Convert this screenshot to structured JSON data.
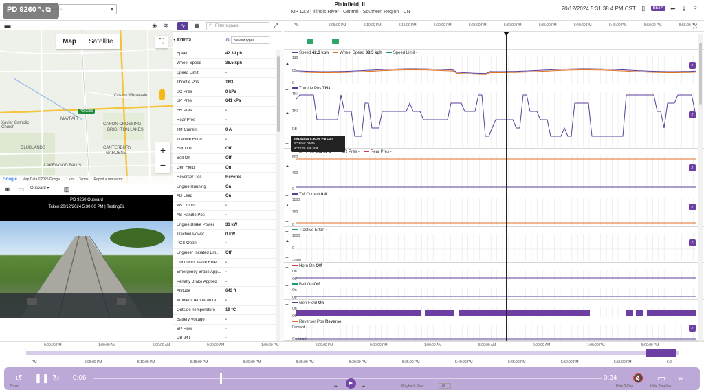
{
  "header": {
    "badge": "PD 9260",
    "signal_placeholder": "Signals",
    "location": "Plainfield, IL",
    "subtitle": "MP 12.8 | Illinois River · Central · Southern Region · CN",
    "datetime": "20/12/2024 5:31:38.4 PM CST",
    "beta": "BETA"
  },
  "map": {
    "tab_map": "Map",
    "tab_satellite": "Satellite",
    "labels": [
      "Costco Wholesale",
      "PD 9260",
      "CLUBLANDS",
      "Xavier Catholic Church",
      "LAKEWOOD FALLS",
      "CANTERBURY",
      "GARDENS",
      "CARON CROSSING",
      "BRIGHTON LAKES",
      "MAYFAIR"
    ],
    "footer_data": "Map Data ©2025 Google",
    "footer_scale": "1 km",
    "footer_terms": "Terms",
    "footer_report": "Report a map error",
    "google": "Google"
  },
  "video": {
    "camera_select": "Outward",
    "caption1": "PD 9260 Outward",
    "caption2": "Taken 20/12/2024 5:30:00 PM | TestingBL"
  },
  "signals": {
    "filter_placeholder": "Filter signals",
    "events_label": "EVENTS",
    "events_select": "3 event types",
    "rows": [
      {
        "name": "Speed",
        "value": "42.3 kph"
      },
      {
        "name": "Wheel Speed",
        "value": "38.5 kph"
      },
      {
        "name": "Speed Limit",
        "value": "-"
      },
      {
        "name": "Throttle Pos",
        "value": "TN3"
      },
      {
        "name": "BC Pres",
        "value": "0 kPa"
      },
      {
        "name": "BP Pres",
        "value": "641 kPa"
      },
      {
        "name": "ER Pres",
        "value": "-"
      },
      {
        "name": "Rear Pres",
        "value": "-"
      },
      {
        "name": "TM Current",
        "value": "0 A"
      },
      {
        "name": "Tractive Effort",
        "value": "-"
      },
      {
        "name": "Horn On",
        "value": "Off"
      },
      {
        "name": "Bell On",
        "value": "Off"
      },
      {
        "name": "Gen Field",
        "value": "On"
      },
      {
        "name": "Reverser Pos",
        "value": "Reverse"
      },
      {
        "name": "Engine Running",
        "value": "On"
      },
      {
        "name": "AB Lead",
        "value": "On"
      },
      {
        "name": "AB Cutout",
        "value": "-"
      },
      {
        "name": "AB Handle Pos",
        "value": "-"
      },
      {
        "name": "Engine Brake Power",
        "value": "31 kW"
      },
      {
        "name": "Traction Power",
        "value": "0 kW"
      },
      {
        "name": "PCS Open",
        "value": "-"
      },
      {
        "name": "Engineer Initiated Em...",
        "value": "Off"
      },
      {
        "name": "Conductor Valve Eme...",
        "value": "-"
      },
      {
        "name": "Emergency Brake App...",
        "value": "-"
      },
      {
        "name": "Penalty Brake Applied",
        "value": "-"
      },
      {
        "name": "Altitude",
        "value": "643 ft"
      },
      {
        "name": "Ambient Temperature",
        "value": "-"
      },
      {
        "name": "Outside Temperature",
        "value": "19 °C"
      },
      {
        "name": "Battery Voltage",
        "value": "-"
      },
      {
        "name": "BP Flow",
        "value": "-"
      },
      {
        "name": "DB 24T",
        "value": "-"
      }
    ]
  },
  "timeline": {
    "ticks": [
      "PM",
      "5:05:00 PM",
      "5:10:00 PM",
      "5:15:00 PM",
      "5:20:00 PM",
      "5:25:00 PM",
      "5:30:00 PM",
      "5:35:00 PM",
      "5:40:00 PM",
      "5:45:00 PM",
      "5:50:00 PM",
      "5:55:00 PM"
    ]
  },
  "panels": {
    "speed": {
      "legend": [
        {
          "label": "Speed",
          "value": "42.3 kph",
          "color": "#5b3e97"
        },
        {
          "label": "Wheel Speed",
          "value": "38.5 kph",
          "color": "#e07020"
        },
        {
          "label": "Speed Limit",
          "value": "-",
          "color": "#1c9b73"
        }
      ],
      "yticks": [
        "130",
        "65",
        "0"
      ]
    },
    "throttle": {
      "legend": [
        {
          "label": "Throttle Pos",
          "value": "TN3",
          "color": "#5b3e97"
        }
      ],
      "yticks": [
        "TN4",
        "TN1",
        "DB",
        "DB7"
      ]
    },
    "brake": {
      "legend": [
        {
          "label": "BP Pres",
          "value": "641 kPa",
          "color": "#5b3e97"
        },
        {
          "label": "ER Pres",
          "value": "-",
          "color": "#1c9b73"
        },
        {
          "label": "Rear Pres",
          "value": "-",
          "color": "#d03b4b"
        }
      ],
      "yticks": [
        "800",
        "400",
        "0"
      ]
    },
    "tm": {
      "legend": [
        {
          "label": "TM Current",
          "value": "0 A",
          "color": "#5b3e97"
        }
      ],
      "yticks": [
        "1500",
        "750",
        "0"
      ]
    },
    "tractive": {
      "legend": [
        {
          "label": "Tractive Effort",
          "value": "-",
          "color": "#1c9b73"
        }
      ],
      "yticks": [
        "1000",
        "0",
        "-1000"
      ]
    },
    "horn": {
      "legend": [
        {
          "label": "Horn On",
          "value": "Off",
          "color": "#d03b4b"
        }
      ],
      "yticks": [
        "On",
        "Off"
      ]
    },
    "bell": {
      "legend": [
        {
          "label": "Bell On",
          "value": "Off",
          "color": "#1c9b73"
        }
      ],
      "yticks": [
        "On",
        "Off"
      ]
    },
    "genfield": {
      "legend": [
        {
          "label": "Gen Field",
          "value": "On",
          "color": "#5b3e97"
        }
      ],
      "yticks": [
        "On",
        "Off"
      ]
    },
    "reverser": {
      "legend": [
        {
          "label": "Reverser Pos",
          "value": "Reverse",
          "color": "#e07020"
        }
      ],
      "yticks": [
        "Forward",
        "Centered"
      ]
    }
  },
  "tooltip": {
    "line1": "20/12/2024 5:30:00 PM CST",
    "line2": "BC Pres: 0 kPa",
    "line3": "BP Pres: 648 kPa"
  },
  "overview": {
    "ticks": [
      "9:00:00 PM",
      "1:00:00 AM",
      "5:00:00 AM",
      "9:00:00 AM",
      "1:00:00 PM",
      "5:00:00 PM",
      "9:00:00 PM",
      "1:00:00 AM",
      "5:00:00 AM",
      "9:00:00 AM",
      "1:00:00 PM",
      "5:00:00 PM"
    ]
  },
  "detail_axis": {
    "ticks": [
      "PM",
      "5:05:00 PM",
      "5:10:00 PM",
      "5:15:00 PM",
      "5:20:00 PM",
      "5:25:00 PM",
      "5:30:00 PM",
      "5:35:00 PM",
      "5:40:00 PM",
      "5:45:00 PM",
      "5:50:00 PM",
      "5:55:00 PM",
      "6:0"
    ]
  },
  "player": {
    "time_elapsed": "0:06",
    "time_total": "0:24",
    "playback_label": "Playback Rate",
    "playback_rate": "1x",
    "zoom_label": "Zoom",
    "hide_label": "Hide 2-Day",
    "hide_timeline": "Hide Timeline",
    "seek_progress": 0.25
  }
}
